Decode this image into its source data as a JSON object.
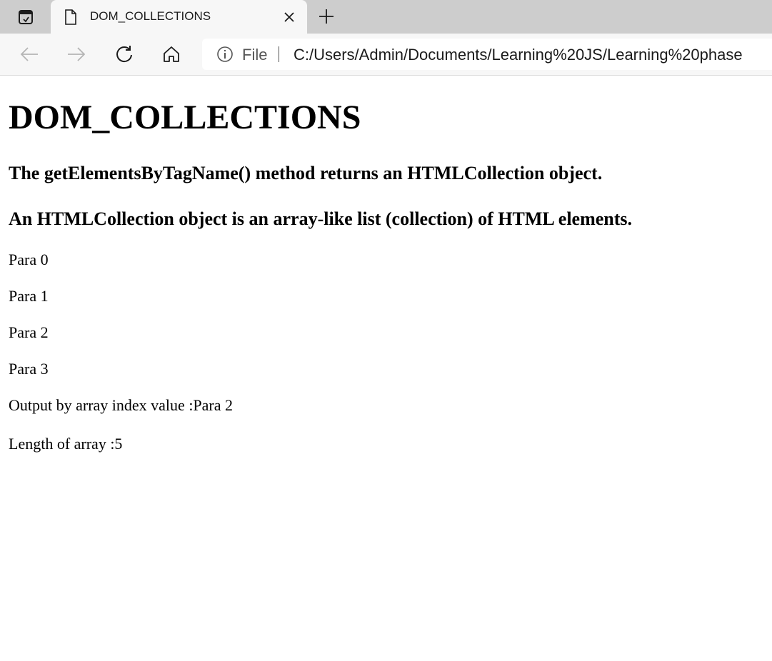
{
  "browser": {
    "tab": {
      "title": "DOM_COLLECTIONS"
    },
    "address": {
      "site_label": "File",
      "url": "C:/Users/Admin/Documents/Learning%20JS/Learning%20phase"
    },
    "icons": {
      "tab_actions": "tab-actions-icon",
      "favicon": "page-icon",
      "close": "close-icon",
      "new_tab": "plus-icon",
      "back": "arrow-left-icon",
      "forward": "arrow-right-icon",
      "refresh": "refresh-icon",
      "home": "home-icon",
      "info": "info-icon"
    },
    "colors": {
      "tabstrip": "#cdcdcd",
      "toolbar": "#f7f7f7"
    }
  },
  "page": {
    "title": "DOM_COLLECTIONS",
    "subheadings": [
      "The getElementsByTagName() method returns an HTMLCollection object.",
      "An HTMLCollection object is an array-like list (collection) of HTML elements."
    ],
    "paragraphs": [
      "Para 0",
      "Para 1",
      "Para 2",
      "Para 3"
    ],
    "output_index": "Output by array index value :Para 2",
    "output_length": "Length of array :5"
  }
}
